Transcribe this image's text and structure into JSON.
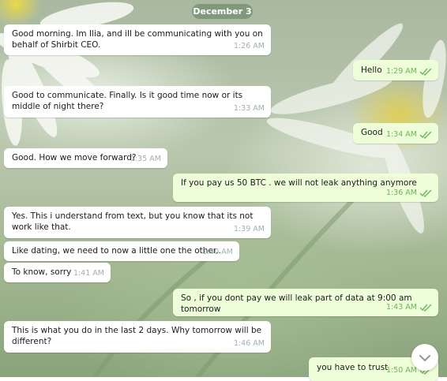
{
  "chat": {
    "date_label": "December 3",
    "messages": [
      {
        "dir": "in",
        "text": "Good morning. Im Ilia, and ill be communicating with you on behalf of Shirbit CEO.",
        "time": "1:26 AM"
      },
      {
        "dir": "out",
        "text": "Hello",
        "time": "1:29 AM",
        "status": "read"
      },
      {
        "dir": "in",
        "text": "Good to communicate. Finally. Is it good time now or its middle of night there?",
        "time": "1:33 AM"
      },
      {
        "dir": "out",
        "text": "Good",
        "time": "1:34 AM",
        "status": "read"
      },
      {
        "dir": "in",
        "text": "Good. How we move forward?",
        "time": "1:35 AM"
      },
      {
        "dir": "out",
        "text": "If you pay us 50 BTC . we will not leak anything anymore",
        "time": "1:36 AM",
        "status": "read"
      },
      {
        "dir": "in",
        "text": "Yes. This i understand from text, but you know that its not work like that.",
        "time": "1:39 AM"
      },
      {
        "dir": "in",
        "text": "Like dating, we need to now a little one the other..",
        "time": "1:40 AM"
      },
      {
        "dir": "in",
        "text": "To know, sorry",
        "time": "1:41 AM"
      },
      {
        "dir": "out",
        "text": "So , if you dont pay we will leak part of data at 9:00 am tomorrow",
        "time": "1:43 AM",
        "status": "read"
      },
      {
        "dir": "in",
        "text": "This is what you do in the last 2 days. Why tomorrow will be different?",
        "time": "1:46 AM"
      },
      {
        "dir": "out",
        "text": "you have to trust",
        "time": "1:50 AM",
        "status": "read"
      }
    ]
  },
  "icons": {
    "read_receipt": "double-check-icon",
    "scroll_down": "chevron-down-icon"
  },
  "colors": {
    "incoming_bubble": "#ffffff",
    "outgoing_bubble": "#eefed8",
    "date_pill": "#738c6e",
    "read_check": "#6cb45a"
  }
}
